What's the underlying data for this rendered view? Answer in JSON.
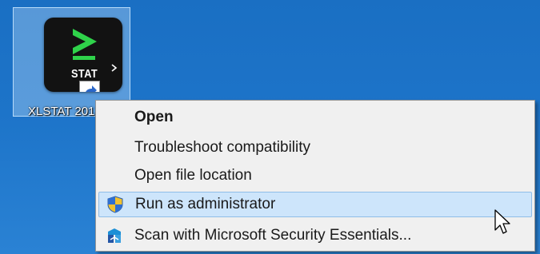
{
  "desktop": {
    "shortcut": {
      "icon_text": "STAT",
      "label": "XLSTAT 2013",
      "icon": "xlstat-shortcut-icon"
    }
  },
  "context_menu": {
    "items": [
      {
        "label": "Open",
        "bold": true,
        "icon": ""
      },
      {
        "label": "Troubleshoot compatibility",
        "bold": false,
        "icon": ""
      },
      {
        "label": "Open file location",
        "bold": false,
        "icon": ""
      },
      {
        "label": "Run as administrator",
        "bold": false,
        "icon": "uac-shield-icon",
        "highlighted": true
      },
      {
        "label": "Scan with Microsoft Security Essentials...",
        "bold": false,
        "icon": "security-essentials-icon"
      }
    ]
  },
  "colors": {
    "desktop_blue": "#1d74c9",
    "menu_background": "#f0f0f0",
    "highlight": "#cde5fb",
    "logo_green": "#2fd24a"
  }
}
